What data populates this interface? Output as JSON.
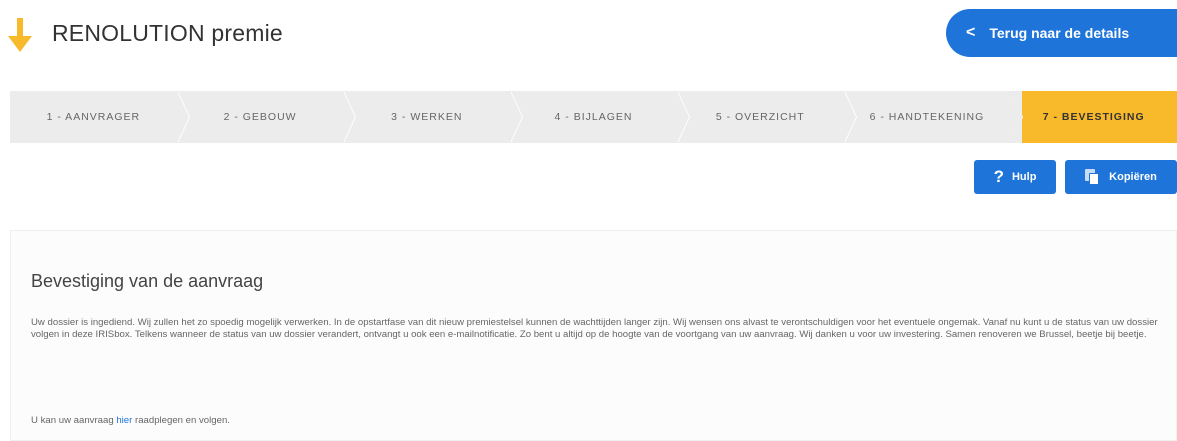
{
  "header": {
    "title": "RENOLUTION premie",
    "back_button": "Terug naar de details",
    "logo_icon": "arrow-down-icon",
    "accent_color": "#f8b92b",
    "primary_color": "#1f74d9"
  },
  "stepper": {
    "steps": [
      {
        "label": "1 - AANVRAGER"
      },
      {
        "label": "2 - GEBOUW"
      },
      {
        "label": "3 - WERKEN"
      },
      {
        "label": "4 - BIJLAGEN"
      },
      {
        "label": "5 - OVERZICHT"
      },
      {
        "label": "6 - HANDTEKENING"
      },
      {
        "label": "7 - BEVESTIGING"
      }
    ],
    "active_step": 7
  },
  "toolbar": {
    "help_label": "Hulp",
    "copy_label": "Kopiëren"
  },
  "confirmation": {
    "heading": "Bevestiging van de aanvraag",
    "body": "Uw dossier is ingediend. Wij zullen het zo spoedig mogelijk verwerken. In de opstartfase van dit nieuw premiestelsel kunnen de wachttijden langer zijn. Wij wensen ons alvast te verontschuldigen voor het eventuele ongemak. Vanaf nu kunt u de status van uw dossier volgen in deze IRISbox. Telkens wanneer de status van uw dossier verandert, ontvangt u ook een e-mailnotificatie. Zo bent u altijd op de hoogte van de voortgang van uw aanvraag. Wij danken u voor uw investering. Samen renoveren we Brussel, beetje bij beetje.",
    "footer_before": "U kan uw aanvraag ",
    "footer_link": "hier",
    "footer_after": " raadplegen en volgen."
  }
}
